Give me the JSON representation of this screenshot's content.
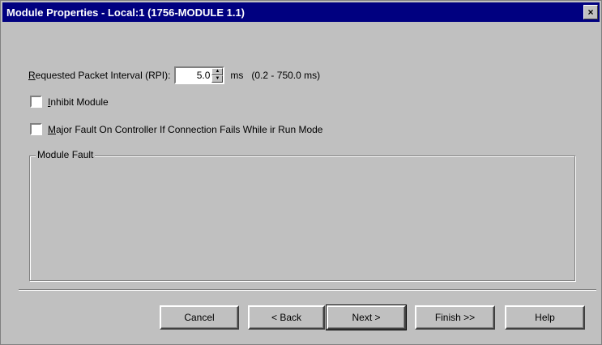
{
  "window": {
    "title": "Module Properties - Local:1 (1756-MODULE 1.1)",
    "close_glyph": "×"
  },
  "rpi": {
    "label_underlined": "R",
    "label_rest": "equested Packet Interval (RPI):",
    "value": "5.0",
    "unit": "ms",
    "range": "(0.2 - 750.0 ms)"
  },
  "inhibit": {
    "label_underlined": "I",
    "label_rest": "nhibit Module",
    "checked": false
  },
  "major_fault": {
    "label_underlined": "M",
    "label_rest": "ajor Fault On Controller If Connection Fails While ir Run Mode",
    "checked": false
  },
  "module_fault": {
    "label": "Module Fault",
    "content": ""
  },
  "buttons": {
    "cancel": "Cancel",
    "back": "< Back",
    "next": "Next >",
    "finish": "Finish >>",
    "help": "Help"
  }
}
